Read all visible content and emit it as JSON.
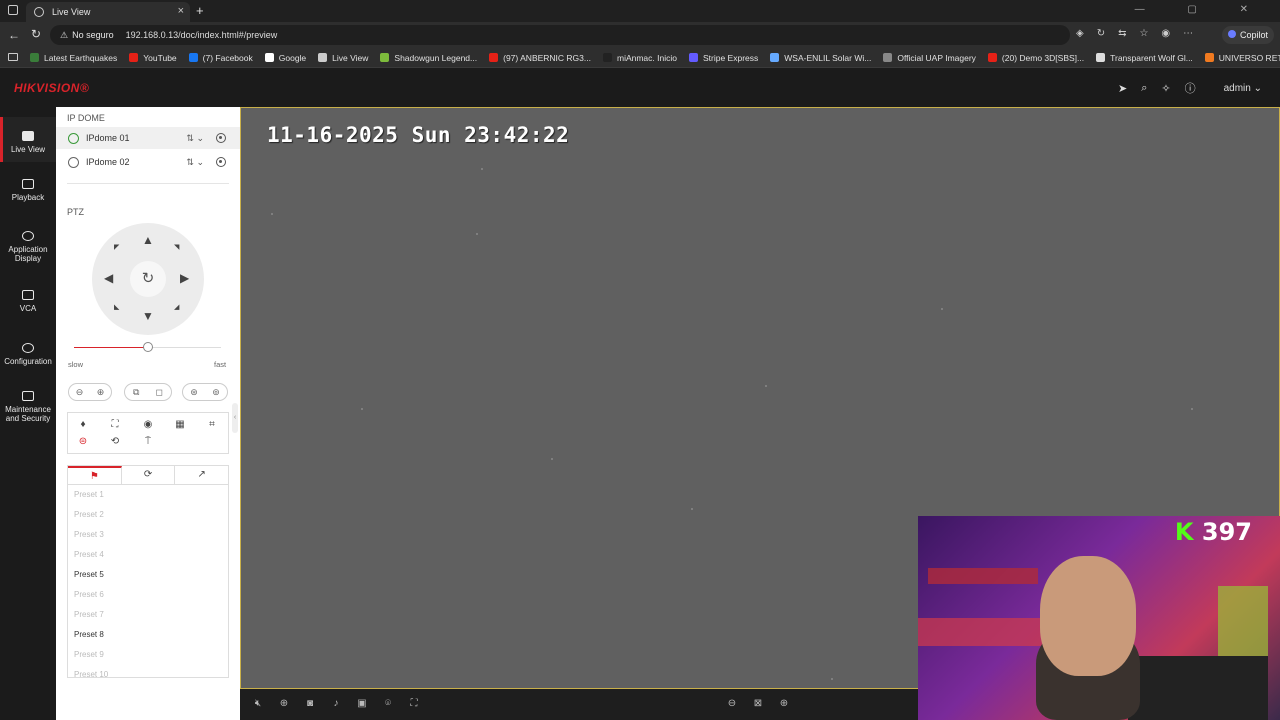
{
  "browser": {
    "tab_title": "Live View",
    "tab_close": "×",
    "new_tab": "+",
    "security_label": "No seguro",
    "url": "192.168.0.13/doc/index.html#/preview",
    "copilot_label": "Copilot",
    "bookmarks": [
      {
        "label": "Latest Earthquakes",
        "color": "#3a7d3a"
      },
      {
        "label": "YouTube",
        "color": "#e62117"
      },
      {
        "label": "(7) Facebook",
        "color": "#1877f2"
      },
      {
        "label": "Google",
        "color": "#ffffff"
      },
      {
        "label": "Live View",
        "color": "#cccccc"
      },
      {
        "label": "Shadowgun Legend...",
        "color": "#7dbb3c"
      },
      {
        "label": "(97) ANBERNIC RG3...",
        "color": "#e62117"
      },
      {
        "label": "miAnmac. Inicio",
        "color": "#222222"
      },
      {
        "label": "Stripe Express",
        "color": "#635bff"
      },
      {
        "label": "WSA-ENLIL Solar Wi...",
        "color": "#66aaff"
      },
      {
        "label": "Official UAP Imagery",
        "color": "#888888"
      },
      {
        "label": "(20) Demo 3D[SBS]...",
        "color": "#e62117"
      },
      {
        "label": "Transparent Wolf Gl...",
        "color": "#dddddd"
      },
      {
        "label": "UNIVERSO RETRO...",
        "color": "#f07a20"
      }
    ]
  },
  "app": {
    "logo": "HIKVISION®",
    "user": "admin",
    "brand_color": "#d8232a"
  },
  "nav": {
    "live_view": "Live View",
    "playback": "Playback",
    "application_display": "Application Display",
    "vca": "VCA",
    "configuration": "Configuration",
    "maintenance": "Maintenance and Security"
  },
  "panel": {
    "group_title": "IP DOME",
    "cameras": [
      "IPdome 01",
      "IPdome 02"
    ],
    "ptz_title": "PTZ",
    "speed_slow": "slow",
    "speed_fast": "fast",
    "speed_value": 0.5,
    "presets": [
      {
        "label": "Preset 1",
        "set": false
      },
      {
        "label": "Preset 2",
        "set": false
      },
      {
        "label": "Preset 3",
        "set": false
      },
      {
        "label": "Preset 4",
        "set": false
      },
      {
        "label": "Preset 5",
        "set": true
      },
      {
        "label": "Preset 6",
        "set": false
      },
      {
        "label": "Preset 7",
        "set": false
      },
      {
        "label": "Preset 8",
        "set": true
      },
      {
        "label": "Preset 9",
        "set": false
      },
      {
        "label": "Preset 10",
        "set": false
      }
    ]
  },
  "video": {
    "osd_timestamp": "11-16-2025 Sun 23:42:22"
  },
  "overlay": {
    "kick_count": "397",
    "kick_letter": "K"
  }
}
